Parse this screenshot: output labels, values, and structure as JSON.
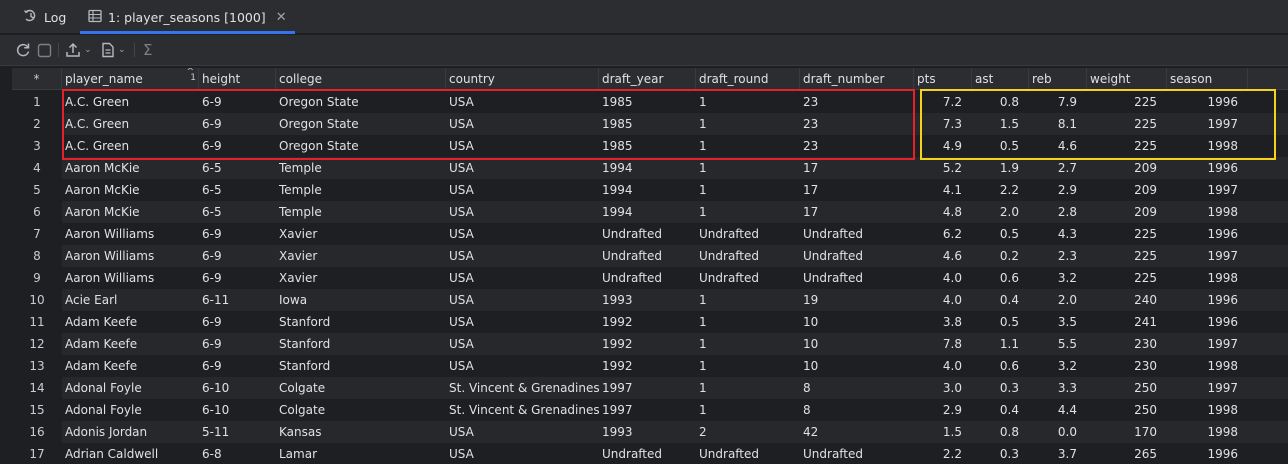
{
  "tabs": [
    {
      "label": "Log",
      "icon": "log-icon",
      "active": false
    },
    {
      "label": "1: player_seasons [1000]",
      "icon": "table-icon",
      "active": true
    }
  ],
  "toolbar": {
    "icons": [
      "refresh-icon",
      "stop-icon",
      "export-icon",
      "file-icon",
      "sum-icon"
    ]
  },
  "table": {
    "corner": "*",
    "sort_indicator": "1",
    "columns": [
      "player_name",
      "height",
      "college",
      "country",
      "draft_year",
      "draft_round",
      "draft_number",
      "pts",
      "ast",
      "reb",
      "weight",
      "season"
    ],
    "rows": [
      [
        "1",
        "A.C. Green",
        "6-9",
        "Oregon State",
        "USA",
        "1985",
        "1",
        "23",
        "7.2",
        "0.8",
        "7.9",
        "225",
        "1996"
      ],
      [
        "2",
        "A.C. Green",
        "6-9",
        "Oregon State",
        "USA",
        "1985",
        "1",
        "23",
        "7.3",
        "1.5",
        "8.1",
        "225",
        "1997"
      ],
      [
        "3",
        "A.C. Green",
        "6-9",
        "Oregon State",
        "USA",
        "1985",
        "1",
        "23",
        "4.9",
        "0.5",
        "4.6",
        "225",
        "1998"
      ],
      [
        "4",
        "Aaron McKie",
        "6-5",
        "Temple",
        "USA",
        "1994",
        "1",
        "17",
        "5.2",
        "1.9",
        "2.7",
        "209",
        "1996"
      ],
      [
        "5",
        "Aaron McKie",
        "6-5",
        "Temple",
        "USA",
        "1994",
        "1",
        "17",
        "4.1",
        "2.2",
        "2.9",
        "209",
        "1997"
      ],
      [
        "6",
        "Aaron McKie",
        "6-5",
        "Temple",
        "USA",
        "1994",
        "1",
        "17",
        "4.8",
        "2.0",
        "2.8",
        "209",
        "1998"
      ],
      [
        "7",
        "Aaron Williams",
        "6-9",
        "Xavier",
        "USA",
        "Undrafted",
        "Undrafted",
        "Undrafted",
        "6.2",
        "0.5",
        "4.3",
        "225",
        "1996"
      ],
      [
        "8",
        "Aaron Williams",
        "6-9",
        "Xavier",
        "USA",
        "Undrafted",
        "Undrafted",
        "Undrafted",
        "4.6",
        "0.2",
        "2.3",
        "225",
        "1997"
      ],
      [
        "9",
        "Aaron Williams",
        "6-9",
        "Xavier",
        "USA",
        "Undrafted",
        "Undrafted",
        "Undrafted",
        "4.0",
        "0.6",
        "3.2",
        "225",
        "1998"
      ],
      [
        "10",
        "Acie Earl",
        "6-11",
        "Iowa",
        "USA",
        "1993",
        "1",
        "19",
        "4.0",
        "0.4",
        "2.0",
        "240",
        "1996"
      ],
      [
        "11",
        "Adam Keefe",
        "6-9",
        "Stanford",
        "USA",
        "1992",
        "1",
        "10",
        "3.8",
        "0.5",
        "3.5",
        "241",
        "1996"
      ],
      [
        "12",
        "Adam Keefe",
        "6-9",
        "Stanford",
        "USA",
        "1992",
        "1",
        "10",
        "7.8",
        "1.1",
        "5.5",
        "230",
        "1997"
      ],
      [
        "13",
        "Adam Keefe",
        "6-9",
        "Stanford",
        "USA",
        "1992",
        "1",
        "10",
        "4.0",
        "0.6",
        "3.2",
        "230",
        "1998"
      ],
      [
        "14",
        "Adonal Foyle",
        "6-10",
        "Colgate",
        "St. Vincent & Grenadines",
        "1997",
        "1",
        "8",
        "3.0",
        "0.3",
        "3.3",
        "250",
        "1997"
      ],
      [
        "15",
        "Adonal Foyle",
        "6-10",
        "Colgate",
        "St. Vincent & Grenadines",
        "1997",
        "1",
        "8",
        "2.9",
        "0.4",
        "4.4",
        "250",
        "1998"
      ],
      [
        "16",
        "Adonis Jordan",
        "5-11",
        "Kansas",
        "USA",
        "1993",
        "2",
        "42",
        "1.5",
        "0.8",
        "0.0",
        "170",
        "1998"
      ],
      [
        "17",
        "Adrian Caldwell",
        "6-8",
        "Lamar",
        "USA",
        "Undrafted",
        "Undrafted",
        "Undrafted",
        "2.2",
        "0.3",
        "3.7",
        "265",
        "1996"
      ]
    ]
  },
  "colors": {
    "highlight_red": "#e5222c",
    "highlight_yellow": "#f5d31c",
    "accent": "#3574f0"
  }
}
